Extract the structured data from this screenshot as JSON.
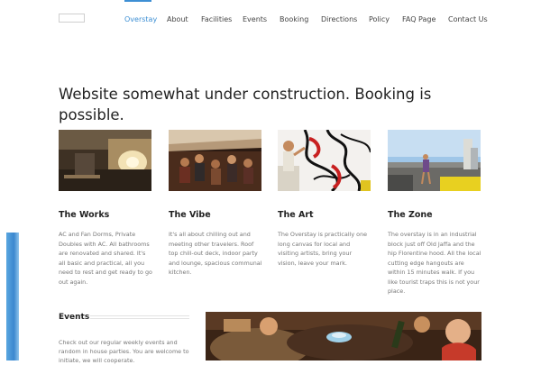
{
  "nav": {
    "items": [
      {
        "label": "Overstay"
      },
      {
        "label": "About"
      },
      {
        "label": "Facilities"
      },
      {
        "label": "Events"
      },
      {
        "label": "Booking"
      },
      {
        "label": "Directions"
      },
      {
        "label": "Policy"
      },
      {
        "label": "FAQ Page"
      },
      {
        "label": "Contact Us"
      }
    ],
    "active_color": "#3d8fd4"
  },
  "hero": {
    "title": "Website somewhat under construction. Booking is possible."
  },
  "cards": [
    {
      "title": "The Works",
      "text": "AC and Fan Dorms, Private Doubles with AC. All bathrooms are renovated and shared. It's all basic and practical, all you need to rest and get ready to go out again."
    },
    {
      "title": "The Vibe",
      "text": "It's all about chilling out and meeting other travelers. Roof top chill-out deck, indoor party and lounge, spacious communal kitchen."
    },
    {
      "title": "The Art",
      "text": "The Overstay is practically one long canvas for local and visiting artists, bring your vision, leave your mark."
    },
    {
      "title": "The Zone",
      "text": "The overstay is in an industrial block just off Old Jaffa and the hip Florentine hood. All the local cutting edge hangouts are within 15 minutes walk. If you like tourist traps this is not your place."
    }
  ],
  "events": {
    "heading": "Events",
    "text": "Check out our regular weekly events and random in house parties. You are welcome to initiate, we will cooperate."
  }
}
